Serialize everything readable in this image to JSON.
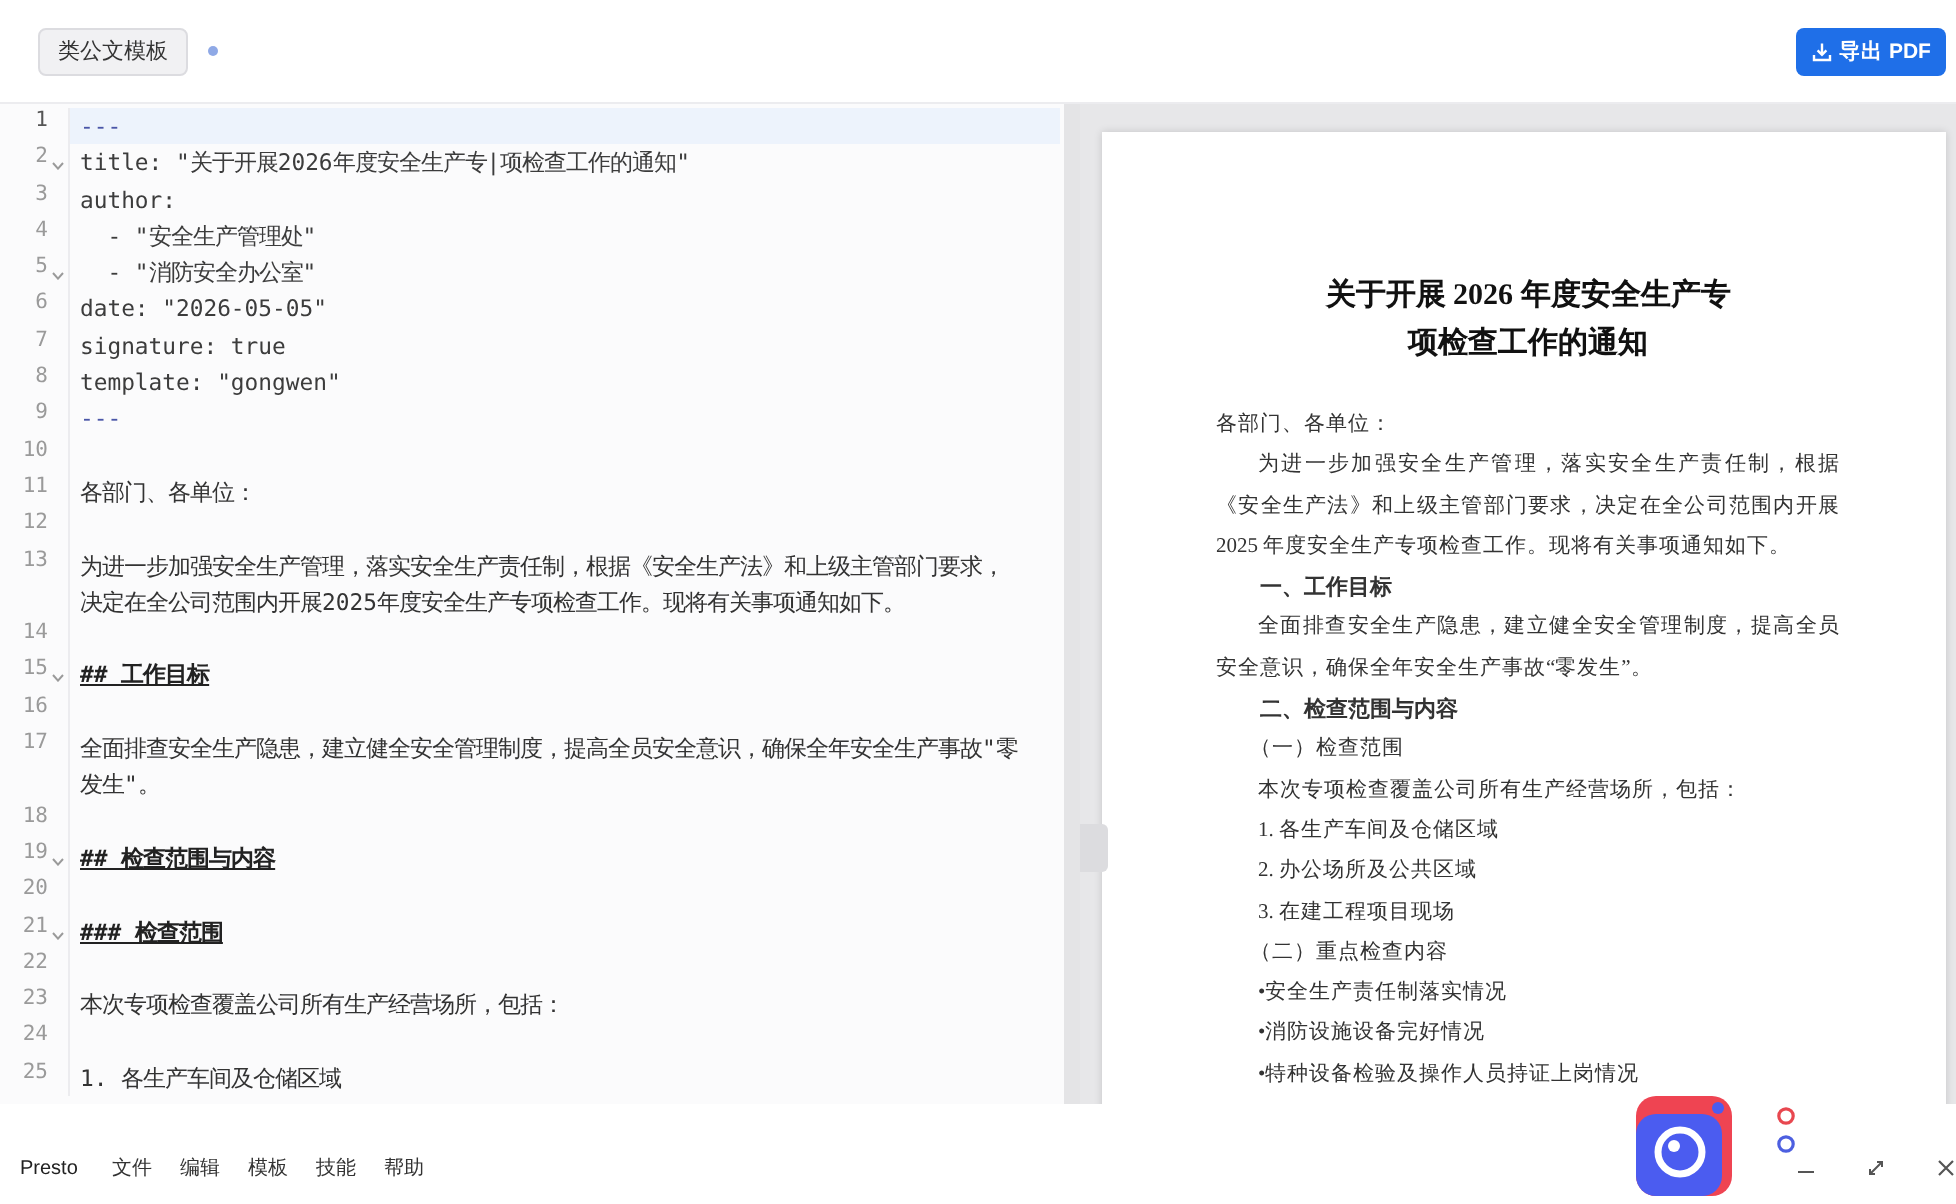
{
  "toolbar": {
    "template_tag": "类公文模板",
    "modified": true,
    "export_label": "导出 PDF"
  },
  "editor": {
    "lines": [
      {
        "number": "1",
        "kind": "delimiter",
        "text": "---",
        "fold": false,
        "active": true
      },
      {
        "number": "2",
        "kind": "yaml",
        "text": "title: \"关于开展2026年度安全生产专|项检查工作的通知\"",
        "fold": true,
        "active": false
      },
      {
        "number": "3",
        "kind": "yaml",
        "text": "author:",
        "fold": false,
        "active": false
      },
      {
        "number": "4",
        "kind": "yaml",
        "text": "  - \"安全生产管理处\"",
        "fold": false,
        "active": false
      },
      {
        "number": "5",
        "kind": "yaml",
        "text": "  - \"消防安全办公室\"",
        "fold": true,
        "active": false
      },
      {
        "number": "6",
        "kind": "yaml",
        "text": "date: \"2026-05-05\"",
        "fold": false,
        "active": false
      },
      {
        "number": "7",
        "kind": "yaml",
        "text": "signature: true",
        "fold": false,
        "active": false
      },
      {
        "number": "8",
        "kind": "yaml",
        "text": "template: \"gongwen\"",
        "fold": false,
        "active": false
      },
      {
        "number": "9",
        "kind": "delimiter",
        "text": "---",
        "fold": false,
        "active": false
      },
      {
        "number": "10",
        "kind": "blank",
        "fold": false,
        "active": false
      },
      {
        "number": "11",
        "kind": "text",
        "text": "各部门、各单位：",
        "fold": false,
        "active": false
      },
      {
        "number": "12",
        "kind": "blank",
        "fold": false,
        "active": false
      },
      {
        "number": "13",
        "kind": "text",
        "text": "为进一步加强安全生产管理，落实安全生产责任制，根据《安全生产法》和上级主管部门要求，决定在全公司范围内开展2025年度安全生产专项检查工作。现将有关事项通知如下。",
        "fold": false,
        "active": false
      },
      {
        "number": "14",
        "kind": "blank",
        "fold": false,
        "active": false
      },
      {
        "number": "15",
        "kind": "heading",
        "text": "## 工作目标",
        "fold": true,
        "active": false
      },
      {
        "number": "16",
        "kind": "blank",
        "fold": false,
        "active": false
      },
      {
        "number": "17",
        "kind": "text",
        "text": "全面排查安全生产隐患，建立健全安全管理制度，提高全员安全意识，确保全年安全生产事故\"零发生\"。",
        "fold": false,
        "active": false
      },
      {
        "number": "18",
        "kind": "blank",
        "fold": false,
        "active": false
      },
      {
        "number": "19",
        "kind": "heading",
        "text": "## 检查范围与内容",
        "fold": true,
        "active": false
      },
      {
        "number": "20",
        "kind": "blank",
        "fold": false,
        "active": false
      },
      {
        "number": "21",
        "kind": "heading",
        "text": "### 检查范围",
        "fold": true,
        "active": false
      },
      {
        "number": "22",
        "kind": "blank",
        "fold": false,
        "active": false
      },
      {
        "number": "23",
        "kind": "text",
        "text": "本次专项检查覆盖公司所有生产经营场所，包括：",
        "fold": false,
        "active": false
      },
      {
        "number": "24",
        "kind": "blank",
        "fold": false,
        "active": false
      },
      {
        "number": "25",
        "kind": "text",
        "text": "1. 各生产车间及仓储区域",
        "fold": false,
        "active": false
      }
    ]
  },
  "preview": {
    "title_lines": [
      "关于开展 2026 年度安全生产专",
      "项检查工作的通知"
    ],
    "blocks": [
      {
        "kind": "salutation",
        "text": "各部门、各单位："
      },
      {
        "kind": "paragraph",
        "text": "为进一步加强安全生产管理，落实安全生产责任制，根据《安全生产法》和上级主管部门要求，决定在全公司范围内开展 2025 年度安全生产专项检查工作。现将有关事项通知如下。"
      },
      {
        "kind": "heading",
        "text": "一、工作目标"
      },
      {
        "kind": "paragraph",
        "text": "全面排查安全生产隐患，建立健全安全管理制度，提高全员安全意识，确保全年安全生产事故“零发生”。"
      },
      {
        "kind": "heading",
        "text": "二、检查范围与内容"
      },
      {
        "kind": "subheading",
        "text": "（一）检查范围"
      },
      {
        "kind": "paragraph",
        "text": "本次专项检查覆盖公司所有生产经营场所，包括："
      },
      {
        "kind": "list_item",
        "text": "1. 各生产车间及仓储区域"
      },
      {
        "kind": "list_item",
        "text": "2. 办公场所及公共区域"
      },
      {
        "kind": "list_item",
        "text": "3. 在建工程项目现场"
      },
      {
        "kind": "subheading",
        "text": "（二）重点检查内容"
      },
      {
        "kind": "bullet",
        "text": "•安全生产责任制落实情况"
      },
      {
        "kind": "bullet",
        "text": "•消防设施设备完好情况"
      },
      {
        "kind": "bullet",
        "text": "•特种设备检验及操作人员持证上岗情况"
      }
    ]
  },
  "menu_bar": {
    "app_name": "Presto",
    "items": [
      "文件",
      "编辑",
      "模板",
      "技能",
      "帮助"
    ]
  }
}
